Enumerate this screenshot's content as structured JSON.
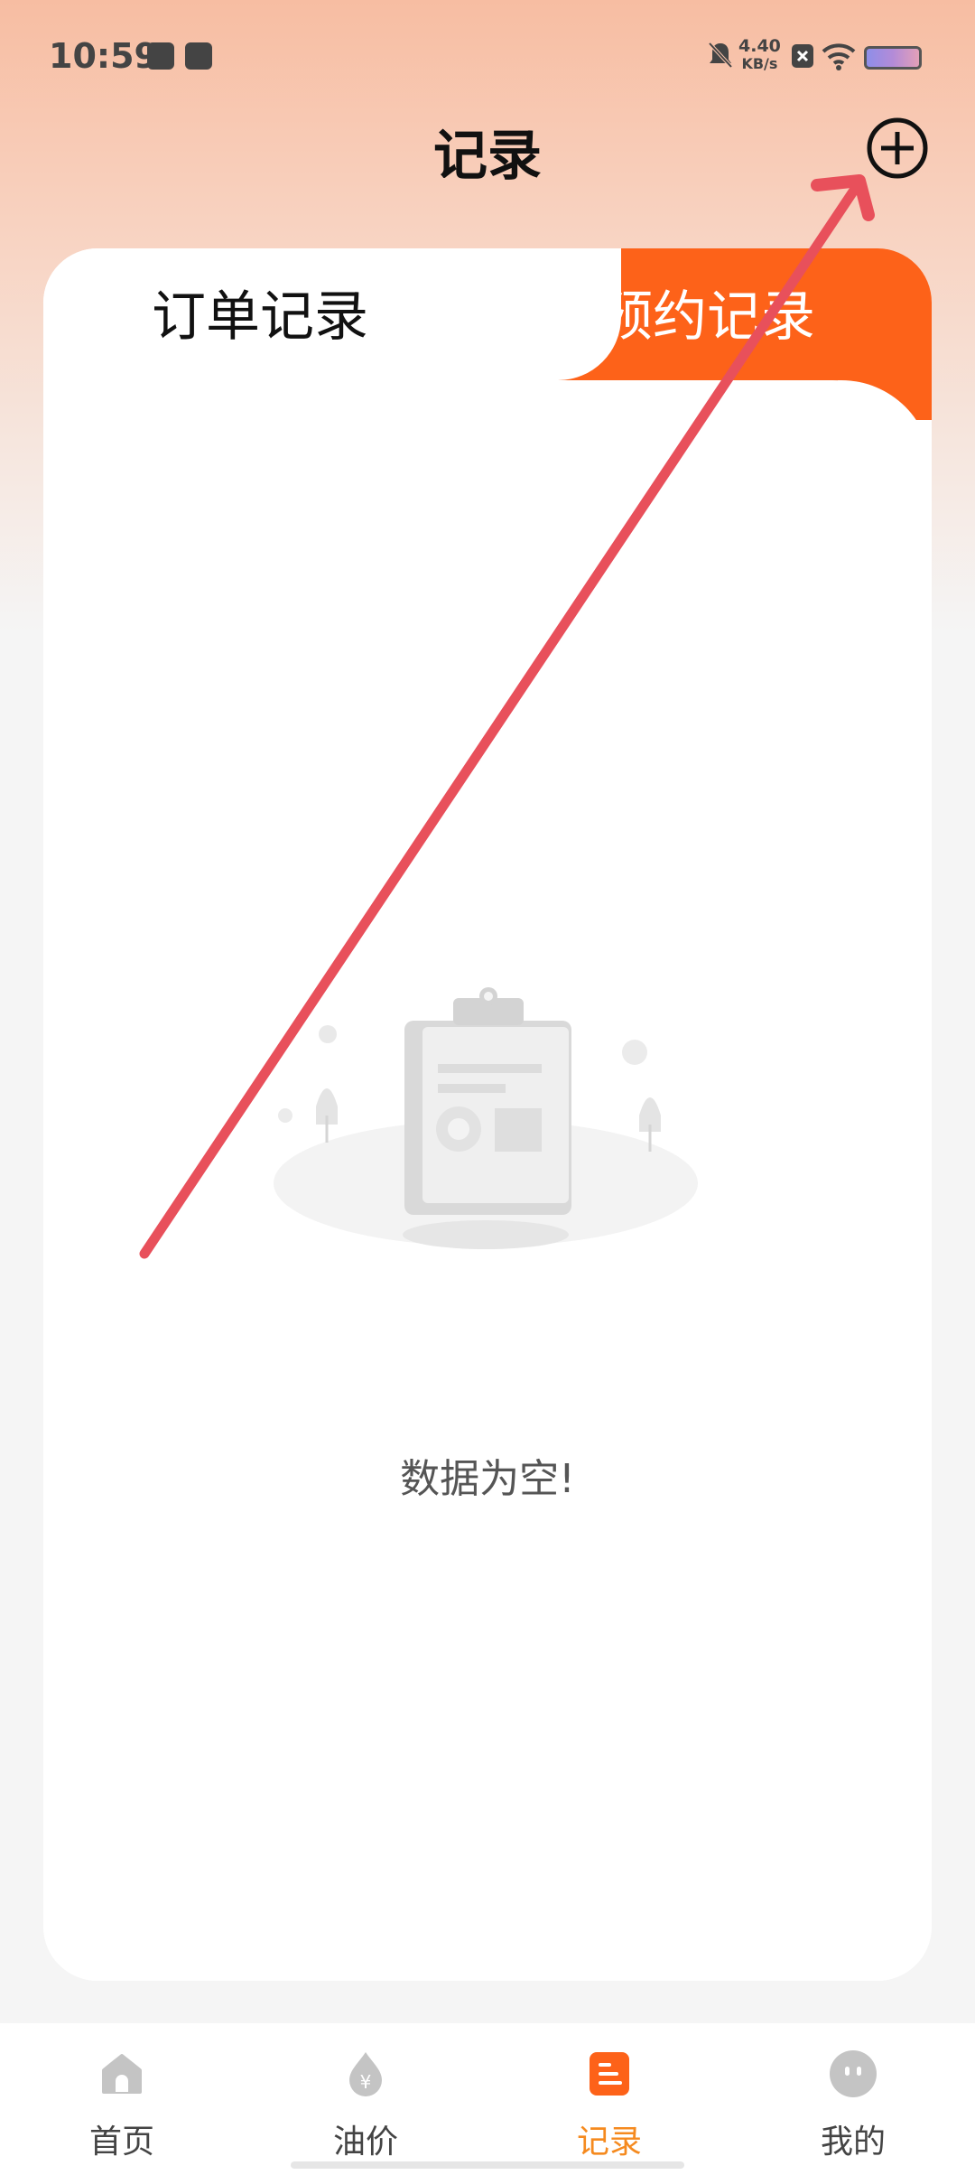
{
  "status_bar": {
    "time": "10:59",
    "net_speed_value": "4.40",
    "net_speed_unit": "KB/s"
  },
  "header": {
    "title": "记录",
    "add_icon": "plus-circle-icon"
  },
  "tabs": [
    {
      "label": "订单记录",
      "active": true
    },
    {
      "label": "预约记录",
      "active": false
    }
  ],
  "empty_state": {
    "icon": "clipboard-empty-icon",
    "message": "数据为空!"
  },
  "bottom_nav": [
    {
      "label": "首页",
      "icon": "home-icon",
      "active": false
    },
    {
      "label": "油价",
      "icon": "oil-drop-yen-icon",
      "active": false
    },
    {
      "label": "记录",
      "icon": "record-list-icon",
      "active": true
    },
    {
      "label": "我的",
      "icon": "profile-face-icon",
      "active": false
    }
  ],
  "colors": {
    "accent": "#fd6219",
    "nav_active": "#f58a1f",
    "annotation_arrow": "#e8505b"
  }
}
